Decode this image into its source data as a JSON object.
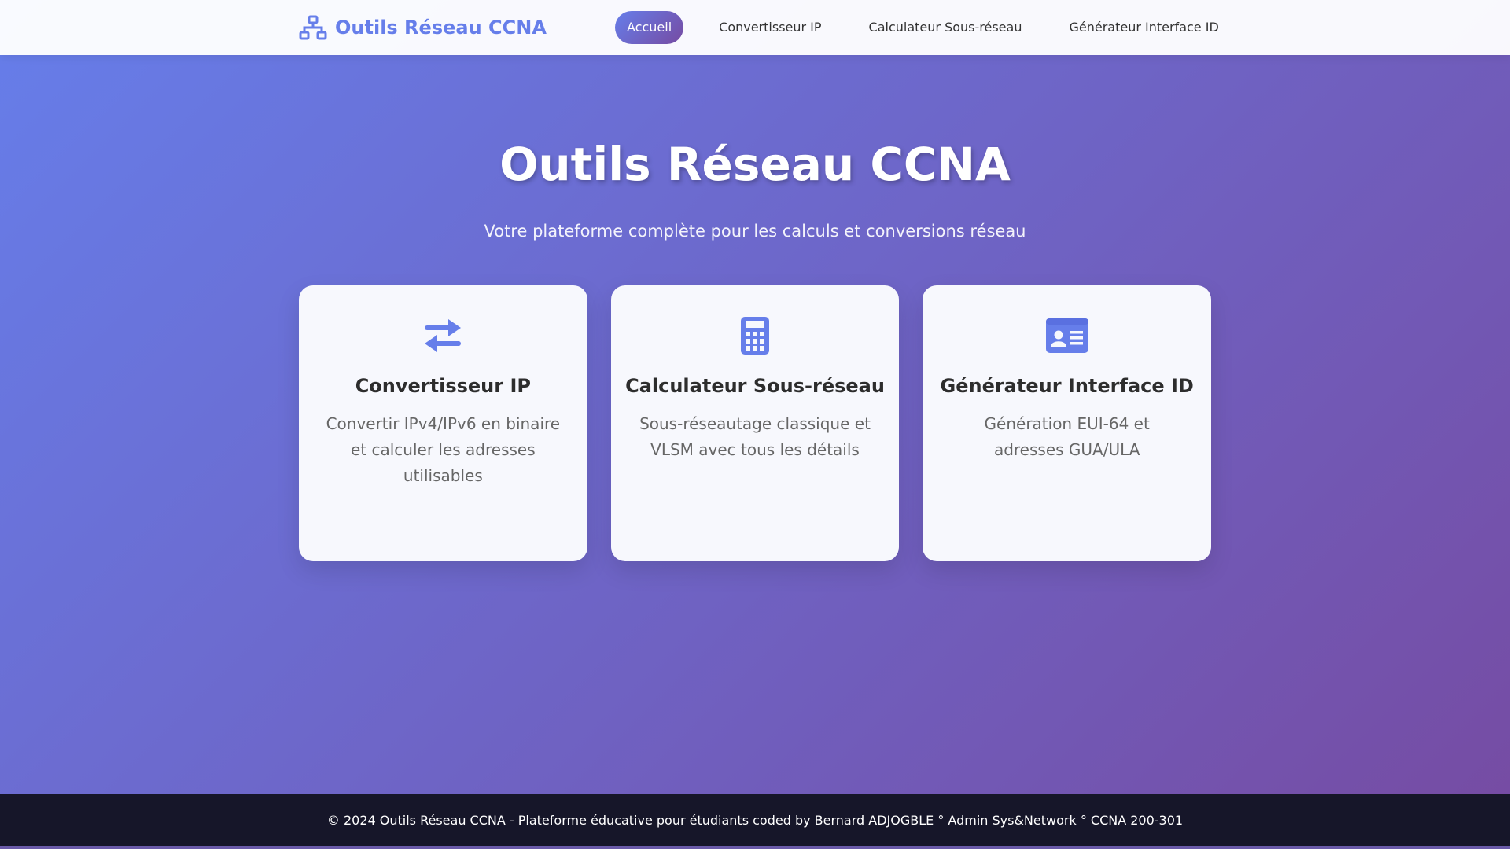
{
  "brand": {
    "name": "Outils Réseau CCNA",
    "icon": "network-icon"
  },
  "nav": {
    "items": [
      {
        "label": "Accueil",
        "active": true
      },
      {
        "label": "Convertisseur IP",
        "active": false
      },
      {
        "label": "Calculateur Sous-réseau",
        "active": false
      },
      {
        "label": "Générateur Interface ID",
        "active": false
      }
    ]
  },
  "hero": {
    "title": "Outils Réseau CCNA",
    "subtitle": "Votre plateforme complète pour les calculs et conversions réseau"
  },
  "cards": [
    {
      "icon": "exchange-arrows-icon",
      "title": "Convertisseur IP",
      "description": "Convertir IPv4/IPv6 en binaire et calculer les adresses utilisables"
    },
    {
      "icon": "calculator-icon",
      "title": "Calculateur Sous-réseau",
      "description": "Sous-réseautage classique et VLSM avec tous les détails"
    },
    {
      "icon": "id-card-icon",
      "title": "Générateur Interface ID",
      "description": "Génération EUI-64 et adresses GUA/ULA"
    }
  ],
  "footer": {
    "text": "© 2024 Outils Réseau CCNA - Plateforme éducative pour étudiants coded by Bernard ADJOGBLE ° Admin Sys&Network ° CCNA 200-301"
  },
  "colors": {
    "accent": "#667eea",
    "gradient_end": "#764ba2",
    "footer_bg": "#161629",
    "card_bg": "#f7f8fd"
  }
}
